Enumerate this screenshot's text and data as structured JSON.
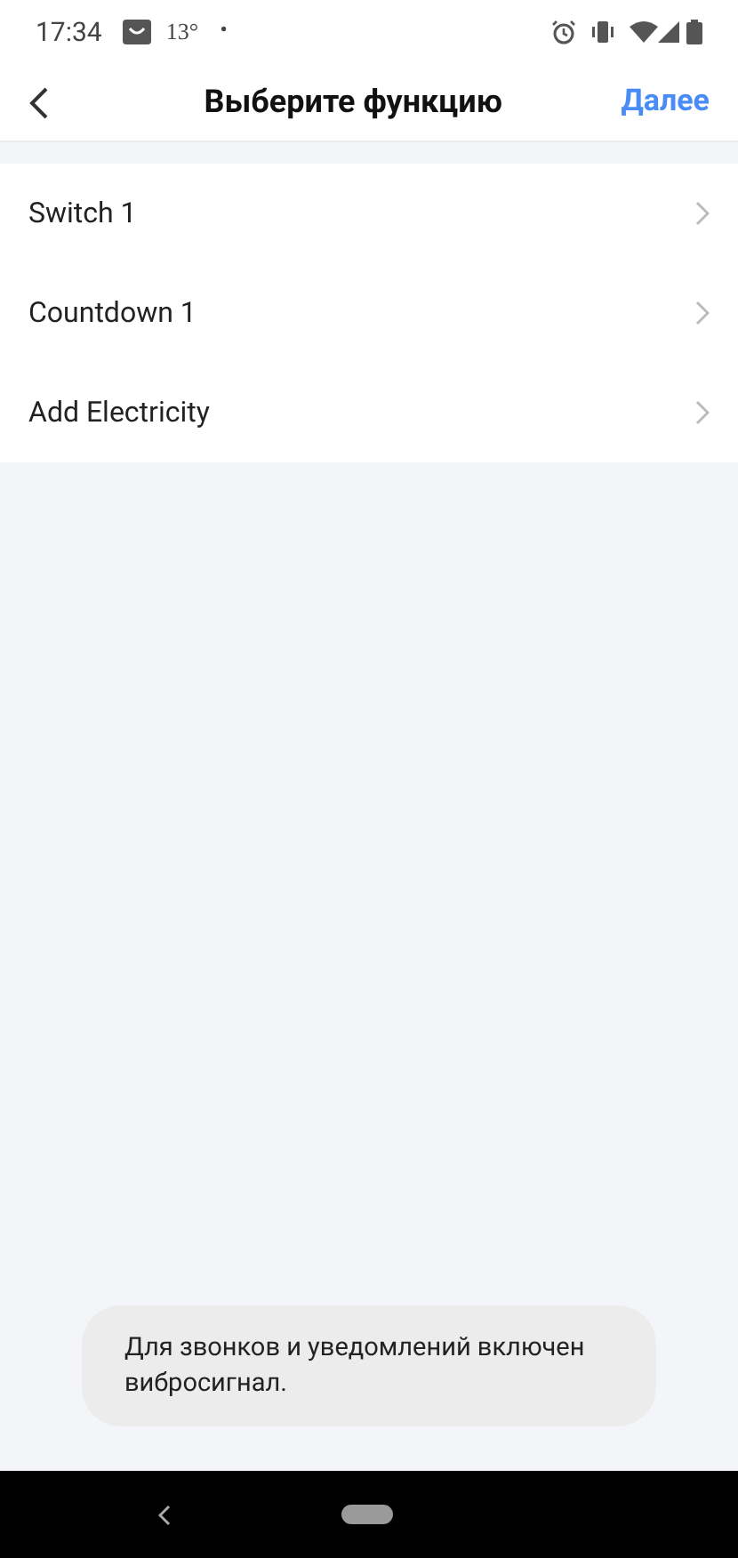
{
  "status_bar": {
    "time": "17:34",
    "temperature": "13°",
    "dot": "•"
  },
  "header": {
    "title": "Выберите функцию",
    "next": "Далее"
  },
  "functions": [
    {
      "label": "Switch 1"
    },
    {
      "label": "Countdown 1"
    },
    {
      "label": "Add Electricity"
    }
  ],
  "toast": {
    "text": "Для звонков и уведомлений включен вибросигнал."
  }
}
